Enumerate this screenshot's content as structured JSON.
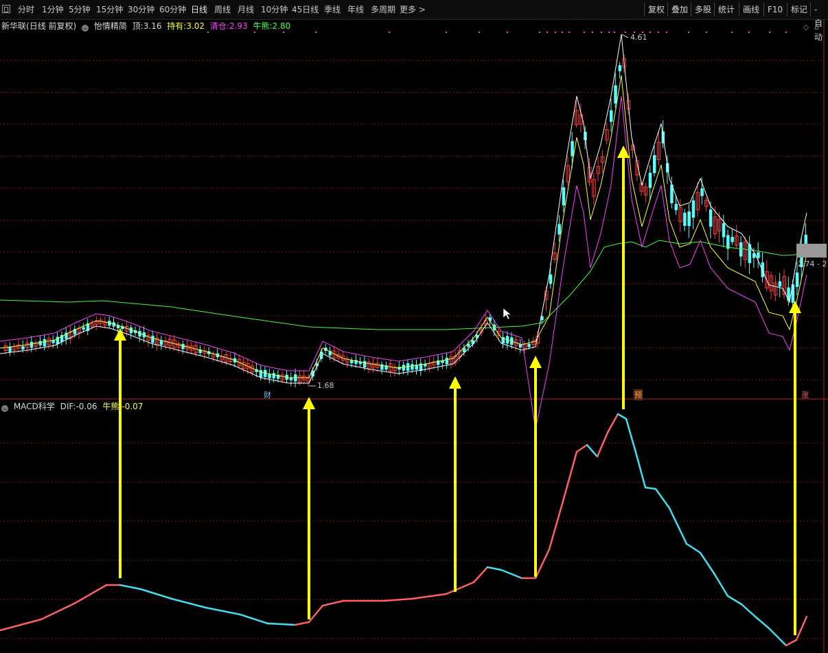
{
  "toolbar": {
    "periods": [
      "分时",
      "1分钟",
      "5分钟",
      "15分钟",
      "30分钟",
      "60分钟",
      "日线",
      "周线",
      "月线",
      "10分钟",
      "45日线",
      "季线",
      "年线",
      "多周期",
      "更多 >"
    ],
    "active": "日线",
    "right": [
      "复权",
      "叠加",
      "多股",
      "统计",
      "画线",
      "F10",
      "标记",
      "-自动"
    ]
  },
  "stock": {
    "name": "新华联",
    "mode": "(日线 前复权)"
  },
  "indicator": {
    "name": "怡情精简",
    "ding_label": "顶:",
    "ding_value": "3.16",
    "chiyou_label": "持有:",
    "chiyou_value": "3.02",
    "qingcang_label": "清仓:",
    "qingcang_value": "2.93",
    "niuxiong_label": "牛熊:",
    "niuxiong_value": "2.80"
  },
  "macd": {
    "name": "MACD科学",
    "dif_label": "DIF:",
    "dif_value": "-0.06",
    "niuxiong_label": "牛熊:",
    "niuxiong_value": "-0.07"
  },
  "annotations": {
    "high_price": "4.61",
    "low_price": "1.68",
    "price_range": "2.74 - 2",
    "event_cai": "财",
    "event_yu": "预",
    "event_zhang": "涨"
  },
  "colors": {
    "up": "#ff3b3b",
    "down": "#54ffff",
    "ding": "#ffffff",
    "chiyou": "#ffff40",
    "qingcang": "#ff40ff",
    "niuxiong": "#40ff40",
    "arrow": "#ffff00",
    "macd_up": "#ff6060",
    "macd_down": "#40e0f0"
  }
}
